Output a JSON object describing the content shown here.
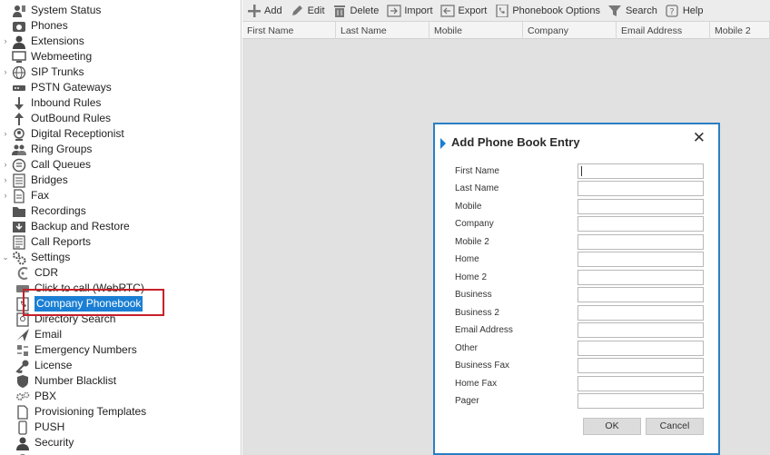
{
  "sidebar": {
    "items": [
      {
        "label": "System Status",
        "arrow": "",
        "icon": "system-status-icon"
      },
      {
        "label": "Phones",
        "arrow": "",
        "icon": "phone-icon"
      },
      {
        "label": "Extensions",
        "arrow": "›",
        "icon": "user-icon"
      },
      {
        "label": "Webmeeting",
        "arrow": "",
        "icon": "webmeeting-icon"
      },
      {
        "label": "SIP Trunks",
        "arrow": "›",
        "icon": "globe-icon"
      },
      {
        "label": "PSTN Gateways",
        "arrow": "",
        "icon": "gateway-icon"
      },
      {
        "label": "Inbound Rules",
        "arrow": "",
        "icon": "arrow-down-icon"
      },
      {
        "label": "OutBound Rules",
        "arrow": "",
        "icon": "arrow-up-icon"
      },
      {
        "label": "Digital Receptionist",
        "arrow": "›",
        "icon": "receptionist-icon"
      },
      {
        "label": "Ring Groups",
        "arrow": "",
        "icon": "group-icon"
      },
      {
        "label": "Call Queues",
        "arrow": "›",
        "icon": "queue-icon"
      },
      {
        "label": "Bridges",
        "arrow": "›",
        "icon": "bridge-icon"
      },
      {
        "label": "Fax",
        "arrow": "›",
        "icon": "fax-icon"
      },
      {
        "label": "Recordings",
        "arrow": "",
        "icon": "folder-icon"
      },
      {
        "label": "Backup and Restore",
        "arrow": "",
        "icon": "backup-icon"
      },
      {
        "label": "Call Reports",
        "arrow": "",
        "icon": "report-icon"
      },
      {
        "label": "Settings",
        "arrow": "⌄",
        "icon": "settings-icon"
      }
    ],
    "sub_items": [
      {
        "label": "CDR",
        "icon": "cdr-icon"
      },
      {
        "label": "Click to call (WebRTC)",
        "icon": "click-to-call-icon"
      },
      {
        "label": "Company Phonebook",
        "icon": "phonebook-icon",
        "selected": true
      },
      {
        "label": "Directory Search",
        "icon": "directory-icon"
      },
      {
        "label": "Email",
        "icon": "email-icon"
      },
      {
        "label": "Emergency Numbers",
        "icon": "emergency-icon"
      },
      {
        "label": "License",
        "icon": "key-icon"
      },
      {
        "label": "Number Blacklist",
        "icon": "shield-icon"
      },
      {
        "label": "PBX",
        "icon": "gears-icon"
      },
      {
        "label": "Provisioning Templates",
        "icon": "template-icon"
      },
      {
        "label": "PUSH",
        "icon": "push-icon"
      },
      {
        "label": "Security",
        "icon": "security-icon"
      }
    ]
  },
  "toolbar": {
    "buttons": [
      {
        "label": "Add",
        "icon": "plus-icon"
      },
      {
        "label": "Edit",
        "icon": "pencil-icon"
      },
      {
        "label": "Delete",
        "icon": "trash-icon"
      },
      {
        "label": "Import",
        "icon": "import-icon"
      },
      {
        "label": "Export",
        "icon": "export-icon"
      },
      {
        "label": "Phonebook Options",
        "icon": "phonebook-options-icon"
      },
      {
        "label": "Search",
        "icon": "funnel-icon"
      },
      {
        "label": "Help",
        "icon": "help-icon"
      }
    ]
  },
  "grid": {
    "columns": [
      "First Name",
      "Last Name",
      "Mobile",
      "Company",
      "Email Address",
      "Mobile 2"
    ]
  },
  "dialog": {
    "title": "Add Phone Book Entry",
    "close": "✕",
    "fields": [
      {
        "label": "First Name",
        "value": ""
      },
      {
        "label": "Last Name",
        "value": ""
      },
      {
        "label": "Mobile",
        "value": ""
      },
      {
        "label": "Company",
        "value": ""
      },
      {
        "label": "Mobile 2",
        "value": ""
      },
      {
        "label": "Home",
        "value": ""
      },
      {
        "label": "Home 2",
        "value": ""
      },
      {
        "label": "Business",
        "value": ""
      },
      {
        "label": "Business 2",
        "value": ""
      },
      {
        "label": "Email Address",
        "value": ""
      },
      {
        "label": "Other",
        "value": ""
      },
      {
        "label": "Business Fax",
        "value": ""
      },
      {
        "label": "Home Fax",
        "value": ""
      },
      {
        "label": "Pager",
        "value": ""
      }
    ],
    "ok_label": "OK",
    "cancel_label": "Cancel"
  },
  "colors": {
    "accent": "#1a7fd4",
    "dialog_border": "#2a7fc4",
    "highlight_box": "#c8202a",
    "content_bg": "#e1e1e1"
  }
}
